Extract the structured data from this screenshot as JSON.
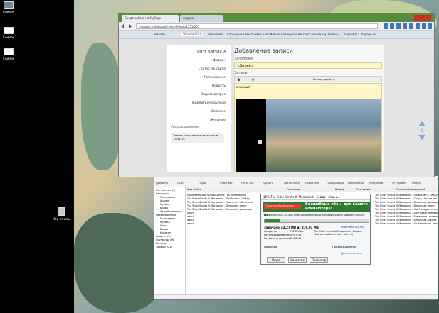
{
  "desktop": {
    "icons": [
      {
        "label": "Снимок"
      },
      {
        "label": "Снимок"
      },
      {
        "label": "Снимок"
      },
      {
        "label": "Мои печать"
      }
    ]
  },
  "browser": {
    "tabs": [
      "Создать блог на MyPage",
      "яндекс"
    ],
    "url": "mypage.ru/blog/add-post/#draft/1551/201",
    "nav": [
      "Начало",
      "Что нового?",
      "Я в клубе",
      "Сообщения",
      "Настройки блога",
      "Мобильная версия",
      "Контакт-менеджер",
      "Помощь"
    ],
    "user": "dvijeh4212.mypage.ru",
    "sidebar": {
      "title": "Тип записи",
      "items": [
        "Мысль",
        "Статус на сайте",
        "Голосование",
        "Новость",
        "Задать вопрос",
        "Поделиться ссылкой",
        "Событие",
        "Желание"
      ],
      "autosave_label": "Автосохранение",
      "autosave_text": "Запись сохранена в черновик в 15:51:31"
    },
    "form": {
      "heading": "Добавление записи",
      "title_label": "Заголовок",
      "title_value": "<более>",
      "body_label": "Запись",
      "font_select": "Размер шрифта",
      "body_text": "скриншот"
    }
  },
  "download_app": {
    "toolbar": [
      "Добавить",
      "Старт",
      "Пауза",
      "Старт все",
      "Пауза все",
      "Удалить",
      "Удалить все",
      "Парам. все",
      "Планировщик",
      "Однократно",
      "Настройки",
      "FTP Explorer",
      "Форум"
    ],
    "tree": [
      "Все закачки (9)",
      "Категории",
      "Программы",
      "Архивы",
      "Музыка",
      "Видео",
      "Автообновление",
      "Незавершённые",
      "Программы",
      "Музыка",
      "Игры",
      "Видео",
      "Новости",
      "Новости (9)",
      "Составные (9)",
      "Истории",
      "Закачки (23)"
    ],
    "columns": [
      "Имя файла",
      "Состояние",
      "Размер",
      "Ост. время",
      "Скорость",
      "Комментарий"
    ],
    "files": [
      {
        "name": "Увлекательное прохождение TES III Morrowind",
        "status": "",
        "size": ""
      },
      {
        "name": "The Elder Scrolls III Morrowind - Прибытие в Сейду",
        "status": "",
        "size": ""
      },
      {
        "name": "The Elder Scrolls III Morrowind - Наш и его обитатели",
        "status": "",
        "size": ""
      },
      {
        "name": "The Elder Scrolls III Morrowind - В поисках денег",
        "status": "",
        "size": ""
      },
      {
        "name": "The Elder Scrolls III Morrowind - В поисках двемеров",
        "status": "",
        "size": ""
      },
      {
        "name": "watch",
        "status": "",
        "size": ""
      },
      {
        "name": "watch",
        "status": "",
        "size": ""
      },
      {
        "name": "watch",
        "status": "",
        "size": ""
      },
      {
        "name": "watch",
        "status": "",
        "size": ""
      }
    ],
    "right_titles": [
      "The Elder Scrolls III Morrowind - Прибытие в Сейду",
      "The Elder Scrolls III Morrowind - Сейда - Наш и его",
      "The Elder Scrolls III Morrowind - В поисках двемеров",
      "The Elder Scrolls III Morrowind - В поисках денег",
      "The Elder Scrolls III Morrowind - Кай Косадес, к чему",
      "The Elder Scrolls III Morrowind - Арнгард и двемерски",
      "The Elder Scrolls III Morrowind - Задания в гильдии",
      "The Elder Scrolls III Morrowind - В поисках апелла",
      "The Elder Scrolls III Morrowind - От Залуны до Тельруна"
    ],
    "progress_dialog": {
      "title": "15% The Elder Scrolls III Morrowind - Сейда - Наш и...",
      "ad_button": "Скачать бесплатно",
      "ad_text": "Волшебные обо... для вашего компьютера!",
      "url_label": "URL:",
      "url": "http://r3---sn-4g57kuer.googlevideo.com/videoplayback?sparams=id%2C",
      "downloaded_label": "Закачано:",
      "downloaded_value": "43,27 MB из 279,93 MB",
      "speed_label": "Скорость:",
      "speed_value": "532,2 KB/s",
      "left_label": "Осталось времени:",
      "left_value": "00:07:35",
      "elapsed_label": "Затрачено времени:",
      "elapsed_value": "00:02:40",
      "file_desc": "The Elder Scrolls III Morrowind - Сейда - Наш и его обитатели (Часть 3)",
      "change_label": "Изменить ссылку",
      "check_label": "Проверка",
      "resume_label": "Поддерживается",
      "more_label": "Дополнительно",
      "progress": 0.15,
      "buttons": [
        "Пауза",
        "Свойства",
        "Просмотр"
      ]
    }
  }
}
